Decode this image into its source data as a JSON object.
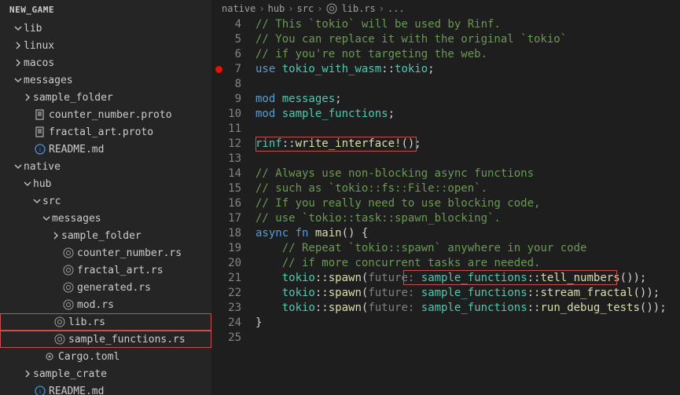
{
  "sidebar": {
    "header": "NEW_GAME",
    "items": [
      {
        "type": "folder",
        "name": "lib",
        "exp": true,
        "ind": 1,
        "chev": "down"
      },
      {
        "type": "folder",
        "name": "linux",
        "exp": false,
        "ind": 1,
        "chev": "right"
      },
      {
        "type": "folder",
        "name": "macos",
        "exp": false,
        "ind": 1,
        "chev": "right"
      },
      {
        "type": "folder",
        "name": "messages",
        "exp": true,
        "ind": 1,
        "chev": "down"
      },
      {
        "type": "folder",
        "name": "sample_folder",
        "exp": false,
        "ind": 2,
        "chev": "right"
      },
      {
        "type": "file",
        "name": "counter_number.proto",
        "icon": "file",
        "ind": 2
      },
      {
        "type": "file",
        "name": "fractal_art.proto",
        "icon": "file",
        "ind": 2
      },
      {
        "type": "file",
        "name": "README.md",
        "icon": "readme",
        "ind": 2
      },
      {
        "type": "folder",
        "name": "native",
        "exp": true,
        "ind": 1,
        "chev": "down"
      },
      {
        "type": "folder",
        "name": "hub",
        "exp": true,
        "ind": 2,
        "chev": "down"
      },
      {
        "type": "folder",
        "name": "src",
        "exp": true,
        "ind": 3,
        "chev": "down"
      },
      {
        "type": "folder",
        "name": "messages",
        "exp": true,
        "ind": 4,
        "chev": "down"
      },
      {
        "type": "folder",
        "name": "sample_folder",
        "exp": false,
        "ind": 5,
        "chev": "right"
      },
      {
        "type": "file",
        "name": "counter_number.rs",
        "icon": "rust",
        "ind": 5
      },
      {
        "type": "file",
        "name": "fractal_art.rs",
        "icon": "rust",
        "ind": 5
      },
      {
        "type": "file",
        "name": "generated.rs",
        "icon": "rust",
        "ind": 5
      },
      {
        "type": "file",
        "name": "mod.rs",
        "icon": "rust",
        "ind": 5
      },
      {
        "type": "file",
        "name": "lib.rs",
        "icon": "rust",
        "ind": 4,
        "hl": true
      },
      {
        "type": "file",
        "name": "sample_functions.rs",
        "icon": "rust",
        "ind": 4,
        "hl": true
      },
      {
        "type": "file",
        "name": "Cargo.toml",
        "icon": "cog",
        "ind": 3
      },
      {
        "type": "folder",
        "name": "sample_crate",
        "exp": false,
        "ind": 2,
        "chev": "right"
      },
      {
        "type": "file",
        "name": "README.md",
        "icon": "readme",
        "ind": 2
      }
    ]
  },
  "breadcrumb": [
    "native",
    "hub",
    "src",
    "lib.rs",
    "..."
  ],
  "breadcrumb_icon_at": 3,
  "code": {
    "start": 4,
    "breakpoints": [
      7
    ],
    "lines": [
      [
        {
          "t": "// This `tokio` will be used by Rinf.",
          "c": "comment"
        }
      ],
      [
        {
          "t": "// You can replace it with the original `tokio`",
          "c": "comment"
        }
      ],
      [
        {
          "t": "// if you're not targeting the web.",
          "c": "comment"
        }
      ],
      [
        {
          "t": "use ",
          "c": "keyword"
        },
        {
          "t": "tokio_with_wasm",
          "c": "ns"
        },
        {
          "t": "::",
          "c": "punct"
        },
        {
          "t": "tokio",
          "c": "ns"
        },
        {
          "t": ";",
          "c": "punct"
        }
      ],
      [],
      [
        {
          "t": "mod ",
          "c": "keyword"
        },
        {
          "t": "messages",
          "c": "ns"
        },
        {
          "t": ";",
          "c": "punct"
        }
      ],
      [
        {
          "t": "mod ",
          "c": "keyword"
        },
        {
          "t": "sample_functions",
          "c": "ns"
        },
        {
          "t": ";",
          "c": "punct"
        }
      ],
      [],
      [
        {
          "t": "rinf",
          "c": "ns"
        },
        {
          "t": "::",
          "c": "punct"
        },
        {
          "t": "write_interface!",
          "c": "macro"
        },
        {
          "t": "();",
          "c": "punct"
        }
      ],
      [],
      [
        {
          "t": "// Always use non-blocking async functions",
          "c": "comment"
        }
      ],
      [
        {
          "t": "// such as `tokio::fs::File::open`.",
          "c": "comment"
        }
      ],
      [
        {
          "t": "// If you really need to use blocking code,",
          "c": "comment"
        }
      ],
      [
        {
          "t": "// use `tokio::task::spawn_blocking`.",
          "c": "comment"
        }
      ],
      [
        {
          "t": "async fn ",
          "c": "keyword"
        },
        {
          "t": "main",
          "c": "fn"
        },
        {
          "t": "() {",
          "c": "punct"
        }
      ],
      [
        {
          "t": "    ",
          "c": "punct"
        },
        {
          "t": "// Repeat `tokio::spawn` anywhere in your code",
          "c": "comment"
        }
      ],
      [
        {
          "t": "    ",
          "c": "punct"
        },
        {
          "t": "// if more concurrent tasks are needed.",
          "c": "comment"
        }
      ],
      [
        {
          "t": "    ",
          "c": "punct"
        },
        {
          "t": "tokio",
          "c": "ns"
        },
        {
          "t": "::",
          "c": "punct"
        },
        {
          "t": "spawn",
          "c": "fn"
        },
        {
          "t": "(",
          "c": "punct"
        },
        {
          "t": "future: ",
          "c": "inlay"
        },
        {
          "t": "sample_functions",
          "c": "ns"
        },
        {
          "t": "::",
          "c": "punct"
        },
        {
          "t": "tell_numbers",
          "c": "fn"
        },
        {
          "t": "());",
          "c": "punct"
        }
      ],
      [
        {
          "t": "    ",
          "c": "punct"
        },
        {
          "t": "tokio",
          "c": "ns"
        },
        {
          "t": "::",
          "c": "punct"
        },
        {
          "t": "spawn",
          "c": "fn"
        },
        {
          "t": "(",
          "c": "punct"
        },
        {
          "t": "future: ",
          "c": "inlay"
        },
        {
          "t": "sample_functions",
          "c": "ns"
        },
        {
          "t": "::",
          "c": "punct"
        },
        {
          "t": "stream_fractal",
          "c": "fn"
        },
        {
          "t": "());",
          "c": "punct"
        }
      ],
      [
        {
          "t": "    ",
          "c": "punct"
        },
        {
          "t": "tokio",
          "c": "ns"
        },
        {
          "t": "::",
          "c": "punct"
        },
        {
          "t": "spawn",
          "c": "fn"
        },
        {
          "t": "(",
          "c": "punct"
        },
        {
          "t": "future: ",
          "c": "inlay"
        },
        {
          "t": "sample_functions",
          "c": "ns"
        },
        {
          "t": "::",
          "c": "punct"
        },
        {
          "t": "run_debug_tests",
          "c": "fn"
        },
        {
          "t": "());",
          "c": "punct"
        }
      ],
      [
        {
          "t": "}",
          "c": "punct"
        }
      ],
      []
    ]
  },
  "colors": {
    "highlight_border": "#c94f4f",
    "background": "#1e1e1e",
    "sidebar": "#252526"
  }
}
